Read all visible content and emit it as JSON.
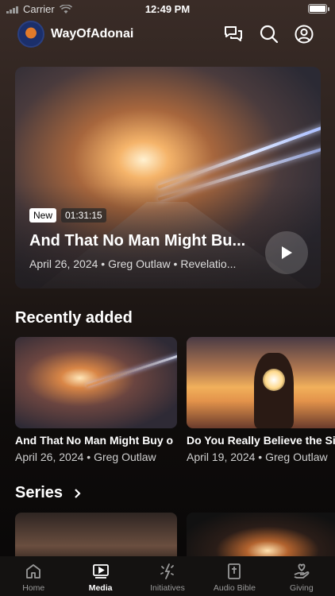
{
  "status_bar": {
    "carrier": "Carrier",
    "time": "12:49 PM"
  },
  "header": {
    "brand": "WayOfAdonai",
    "icons": [
      "chat-icon",
      "search-icon",
      "profile-icon"
    ]
  },
  "hero": {
    "badge_new": "New",
    "duration": "01:31:15",
    "title": "And That No Man Might Bu...",
    "meta": "April 26, 2024 • Greg Outlaw • Revelatio..."
  },
  "recently_added": {
    "title": "Recently added",
    "items": [
      {
        "title": "And That No Man Might Buy o",
        "meta": "April 26, 2024 • Greg Outlaw"
      },
      {
        "title": "Do You Really Believe the Si",
        "meta": "April 19, 2024 • Greg Outlaw"
      }
    ]
  },
  "series": {
    "title": "Series"
  },
  "tabs": [
    {
      "label": "Home",
      "icon": "home-icon",
      "active": false
    },
    {
      "label": "Media",
      "icon": "media-icon",
      "active": true
    },
    {
      "label": "Initiatives",
      "icon": "sparkle-icon",
      "active": false
    },
    {
      "label": "Audio Bible",
      "icon": "bible-icon",
      "active": false
    },
    {
      "label": "Giving",
      "icon": "giving-icon",
      "active": false
    }
  ],
  "colors": {
    "accent": "#ffffff",
    "tab_inactive": "#9a9a9a"
  }
}
